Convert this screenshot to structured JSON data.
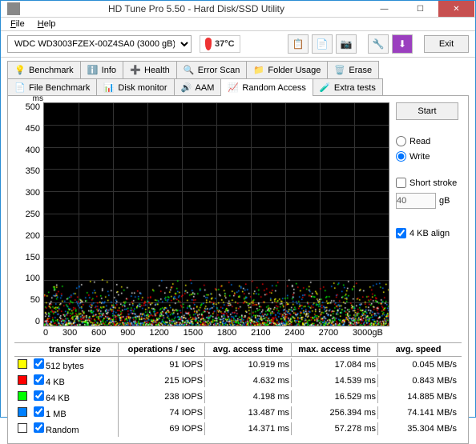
{
  "window": {
    "title": "HD Tune Pro 5.50 - Hard Disk/SSD Utility"
  },
  "menu": {
    "file": "File",
    "help": "Help"
  },
  "toolbar": {
    "drive": "WDC WD3003FZEX-00Z4SA0 (3000 gB)",
    "temp": "37°C",
    "exit": "Exit"
  },
  "tabs": {
    "row1": [
      {
        "label": "Benchmark"
      },
      {
        "label": "Info"
      },
      {
        "label": "Health"
      },
      {
        "label": "Error Scan"
      },
      {
        "label": "Folder Usage"
      },
      {
        "label": "Erase"
      }
    ],
    "row2": [
      {
        "label": "File Benchmark"
      },
      {
        "label": "Disk monitor"
      },
      {
        "label": "AAM"
      },
      {
        "label": "Random Access"
      },
      {
        "label": "Extra tests"
      }
    ]
  },
  "chart_data": {
    "type": "scatter",
    "title": "",
    "xlabel": "gB",
    "ylabel": "ms",
    "xlim": [
      0,
      3000
    ],
    "ylim": [
      0,
      500
    ],
    "xticks": [
      0,
      300,
      600,
      900,
      1200,
      1500,
      1800,
      2100,
      2400,
      2700,
      3000
    ],
    "yticks": [
      0,
      50,
      100,
      150,
      200,
      250,
      300,
      350,
      400,
      450,
      500
    ],
    "note": "Dense scatter of access-time samples near 0–50 ms across full 0–3000 gB range; colored by transfer size series",
    "series": [
      {
        "name": "512 bytes",
        "color": "#ffff00"
      },
      {
        "name": "4 KB",
        "color": "#ff0000"
      },
      {
        "name": "64 KB",
        "color": "#00ff00"
      },
      {
        "name": "1 MB",
        "color": "#0080ff"
      },
      {
        "name": "Random",
        "color": "#ffffff"
      }
    ]
  },
  "controls": {
    "start": "Start",
    "read": "Read",
    "write": "Write",
    "mode_selected": "write",
    "short_stroke": "Short stroke",
    "short_stroke_checked": false,
    "stroke_value": "40",
    "stroke_unit": "gB",
    "align4kb": "4 KB align",
    "align4kb_checked": true
  },
  "table": {
    "headers": {
      "transfer_size": "transfer size",
      "ops": "operations / sec",
      "avg": "avg. access time",
      "max": "max. access time",
      "speed": "avg. speed"
    },
    "rows": [
      {
        "color": "#ffff00",
        "label": "512 bytes",
        "ops": "91 IOPS",
        "avg": "10.919 ms",
        "max": "17.084 ms",
        "speed": "0.045 MB/s"
      },
      {
        "color": "#ff0000",
        "label": "4 KB",
        "ops": "215 IOPS",
        "avg": "4.632 ms",
        "max": "14.539 ms",
        "speed": "0.843 MB/s"
      },
      {
        "color": "#00ff00",
        "label": "64 KB",
        "ops": "238 IOPS",
        "avg": "4.198 ms",
        "max": "16.529 ms",
        "speed": "14.885 MB/s"
      },
      {
        "color": "#0080ff",
        "label": "1 MB",
        "ops": "74 IOPS",
        "avg": "13.487 ms",
        "max": "256.394 ms",
        "speed": "74.141 MB/s"
      },
      {
        "color": "#ffffff",
        "label": "Random",
        "ops": "69 IOPS",
        "avg": "14.371 ms",
        "max": "57.278 ms",
        "speed": "35.304 MB/s"
      }
    ]
  }
}
